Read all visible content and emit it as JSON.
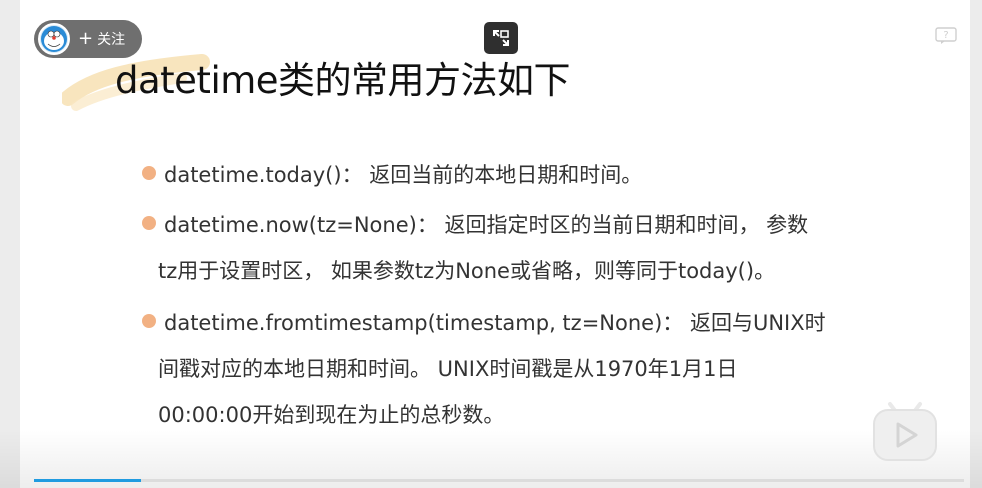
{
  "slide": {
    "title": "datetime类的常用方法如下",
    "bullets": [
      {
        "lines": [
          "datetime.today()：  返回当前的本地日期和时间。"
        ]
      },
      {
        "lines": [
          "datetime.now(tz=None)：  返回指定时区的当前日期和时间，  参数",
          "tz用于设置时区，  如果参数tz为None或省略，则等同于today()。"
        ]
      },
      {
        "lines": [
          "datetime.fromtimestamp(timestamp, tz=None)：  返回与UNIX时",
          "间戳对应的本地日期和时间。  UNIX时间戳是从1970年1月1日",
          "00:00:00开始到现在为止的总秒数。"
        ]
      }
    ],
    "bullet_color": "#f2b183"
  },
  "player": {
    "follow_label": "关注",
    "restore_icon": "restore-screen-icon",
    "help_icon": "help-icon",
    "play_icon": "play-icon",
    "progress": 0.115,
    "progress_color": "#1f9be0"
  }
}
